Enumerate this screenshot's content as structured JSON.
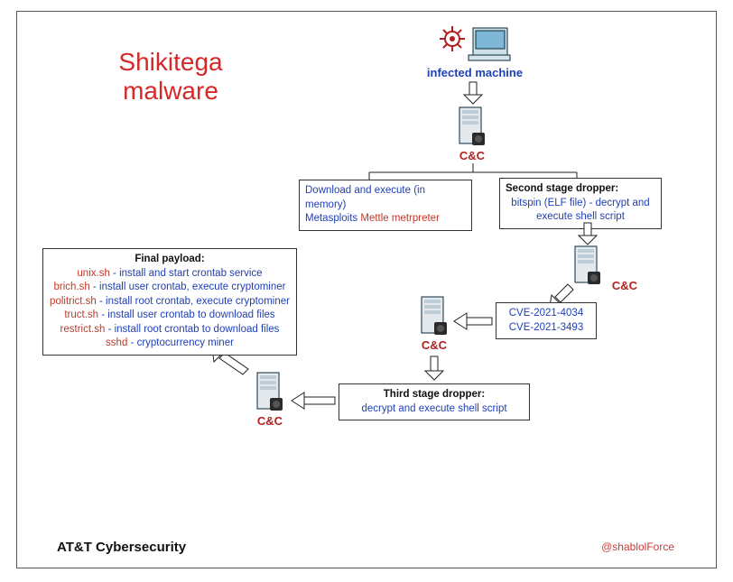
{
  "title": {
    "line1": "Shikitega",
    "line2": "malware"
  },
  "infected_label": "infected machine",
  "cc": "C&C",
  "metasploit": {
    "line1a": "Download and execute (in memory)",
    "line2a": "Metasploits ",
    "line2b": "Mettle metrpreter"
  },
  "second_stage": {
    "head": "Second stage dropper:",
    "l1": "bitspin (ELF file) - decrypt and",
    "l2": "execute shell script"
  },
  "cves": {
    "l1": "CVE-2021-4034",
    "l2": "CVE-2021-3493"
  },
  "third_stage": {
    "head": "Third stage dropper:",
    "l1": "decrypt and execute shell script"
  },
  "payload": {
    "head": "Final payload:",
    "r1a": "unix.sh",
    "r1b": " - install and start crontab service",
    "r2a": "brich.sh",
    "r2b": " - install user crontab, execute cryptominer",
    "r3a": "politrict.sh",
    "r3b": " - install root crontab, execute cryptominer",
    "r4a": "truct.sh",
    "r4b": " - install user crontab to download files",
    "r5a": "restrict.sh",
    "r5b": " - install root crontab to download files",
    "r6a": "sshd",
    "r6b": " - cryptocurrency miner"
  },
  "footer": {
    "left": "AT&T Cybersecurity",
    "right": "@shablolForce"
  }
}
